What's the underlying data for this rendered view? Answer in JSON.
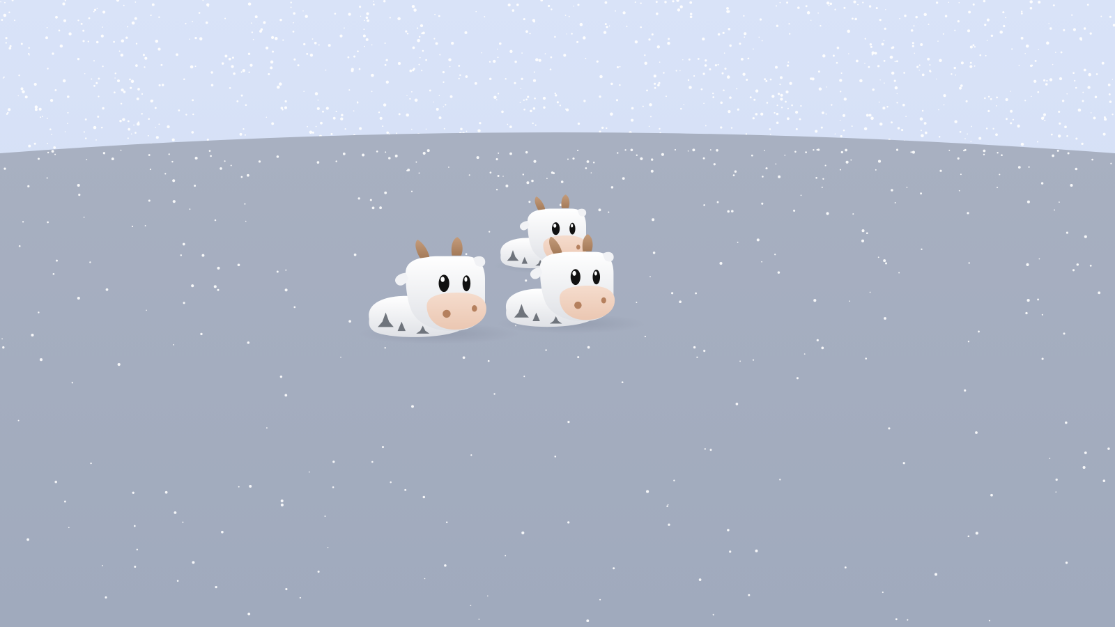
{
  "scene": {
    "kind": "3d-snow-scene",
    "sky_color": "#d6e0f6",
    "ground_color": "#a2abbe",
    "snow_color": "#ffffff",
    "cow_count": 3,
    "cow_colors": {
      "body": "#f8f8fa",
      "spots": "#6f747c",
      "horn": "#b48a69",
      "muzzle": "#f1d3c1",
      "nostril": "#b5805e",
      "eye": "#111111"
    }
  }
}
